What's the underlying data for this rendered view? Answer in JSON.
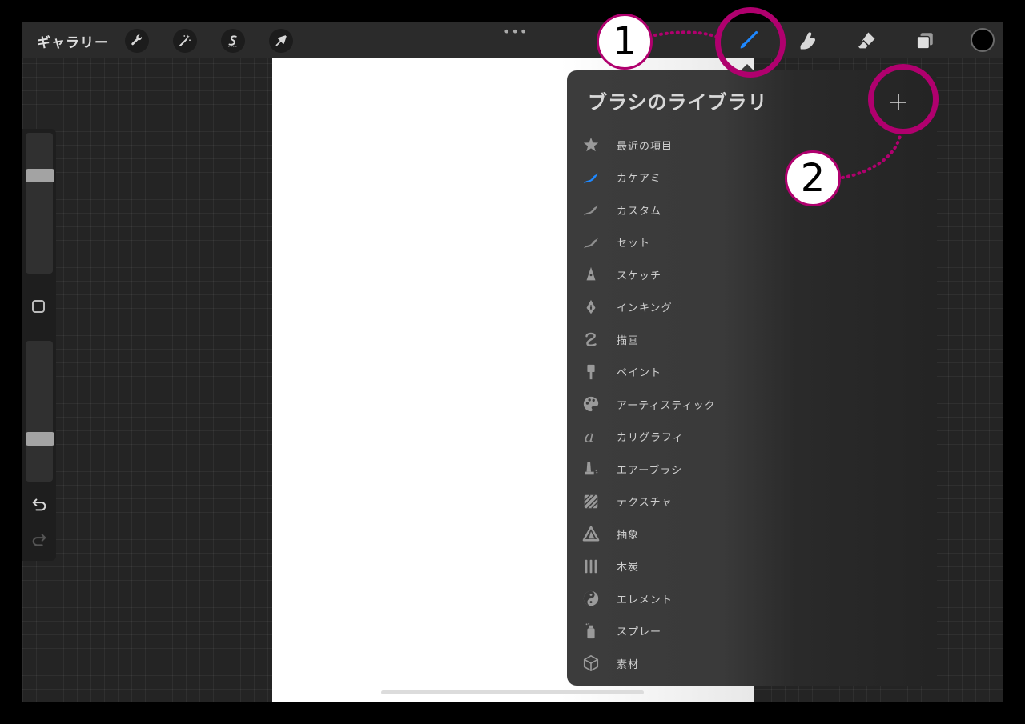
{
  "topbar": {
    "gallery_label": "ギャラリー",
    "left_tools": [
      {
        "name": "actions-wrench",
        "icon": "wrench-icon"
      },
      {
        "name": "adjustments-wand",
        "icon": "magic-wand-icon"
      },
      {
        "name": "selection",
        "icon": "selection-s-icon"
      },
      {
        "name": "transform",
        "icon": "arrow-cursor-icon"
      }
    ],
    "more_label": "•••",
    "right_tools": [
      {
        "name": "brush",
        "icon": "brush-icon",
        "active": true,
        "active_color": "#1e88ff"
      },
      {
        "name": "smudge",
        "icon": "smudge-finger-icon"
      },
      {
        "name": "eraser",
        "icon": "eraser-icon"
      },
      {
        "name": "layers",
        "icon": "layers-icon"
      }
    ],
    "current_color": "#000000"
  },
  "sidebar": {
    "brush_size_level": 0.72,
    "opacity_level": 0.28
  },
  "brush_library": {
    "title": "ブラシのライブラリ",
    "add_label": "+",
    "categories": [
      {
        "label": "最近の項目",
        "icon": "star-icon"
      },
      {
        "label": "カケアミ",
        "icon": "stroke-icon",
        "highlight": true
      },
      {
        "label": "カスタム",
        "icon": "stroke-icon"
      },
      {
        "label": "セット",
        "icon": "stroke-icon"
      },
      {
        "label": "スケッチ",
        "icon": "pencil-tip-icon"
      },
      {
        "label": "インキング",
        "icon": "pen-nib-icon"
      },
      {
        "label": "描画",
        "icon": "squiggle-icon"
      },
      {
        "label": "ペイント",
        "icon": "paint-brush-icon"
      },
      {
        "label": "アーティスティック",
        "icon": "palette-icon"
      },
      {
        "label": "カリグラフィ",
        "icon": "calligraphy-a-icon"
      },
      {
        "label": "エアーブラシ",
        "icon": "airbrush-icon"
      },
      {
        "label": "テクスチャ",
        "icon": "texture-icon"
      },
      {
        "label": "抽象",
        "icon": "triangle-icon"
      },
      {
        "label": "木炭",
        "icon": "charcoal-icon"
      },
      {
        "label": "エレメント",
        "icon": "yin-yang-icon"
      },
      {
        "label": "スプレー",
        "icon": "spray-can-icon"
      },
      {
        "label": "素材",
        "icon": "cube-icon"
      }
    ]
  },
  "annotations": {
    "step1_label": "1",
    "step2_label": "2",
    "accent_color": "#b0006e"
  }
}
